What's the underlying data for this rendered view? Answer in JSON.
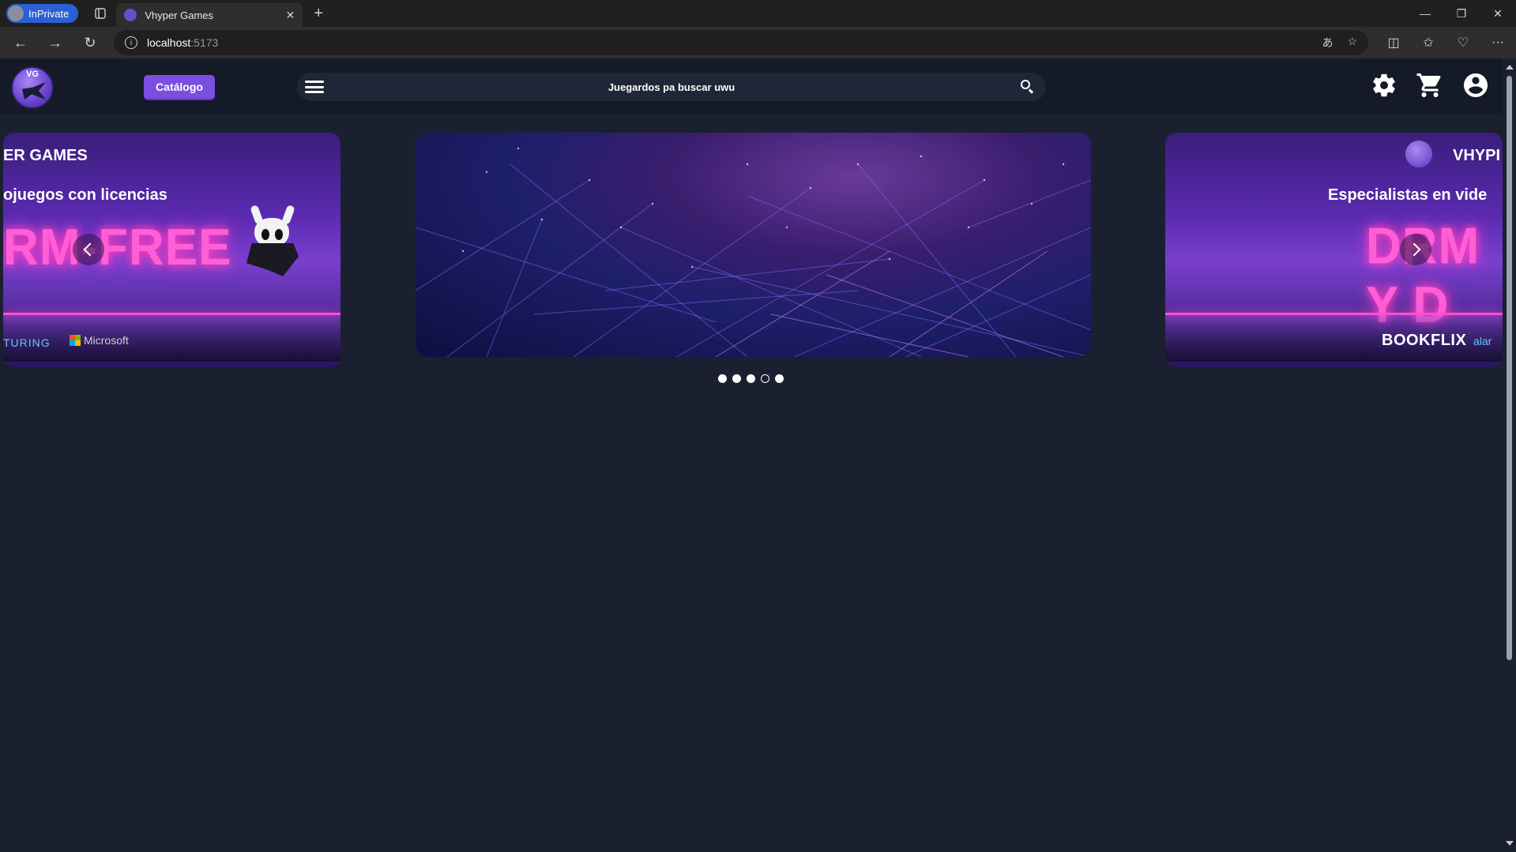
{
  "browser": {
    "inprivate_label": "InPrivate",
    "tab_title": "Vhyper Games",
    "url_host": "localhost",
    "url_port": ":5173"
  },
  "navbar": {
    "catalog_button": "Catálogo",
    "search_placeholder": "Juegardos pa buscar uwu",
    "logo_text": "VG",
    "icons": [
      "menu-icon",
      "search-icon",
      "settings-icon",
      "cart-icon",
      "account-icon"
    ]
  },
  "carousel": {
    "left_slide": {
      "heading": "ER GAMES",
      "subtitle": "ojuegos con licencias",
      "big_text": "RM-FREE",
      "brand_1": "TURING",
      "brand_2": "Microsoft"
    },
    "right_slide": {
      "heading": "VHYPI",
      "subtitle": "Especialistas en vide",
      "big_text": "DRM Y D",
      "brand_1": "BOOKFLIX",
      "brand_2": "alar"
    },
    "dots": [
      {
        "active": false
      },
      {
        "active": false
      },
      {
        "active": false
      },
      {
        "active": true
      },
      {
        "active": false
      }
    ],
    "active_index": 3
  },
  "colors": {
    "page_bg": "#1b2031",
    "navbar_bg": "#141a28",
    "accent": "#7a4fe0",
    "neon_pink": "#ff5fd6"
  }
}
